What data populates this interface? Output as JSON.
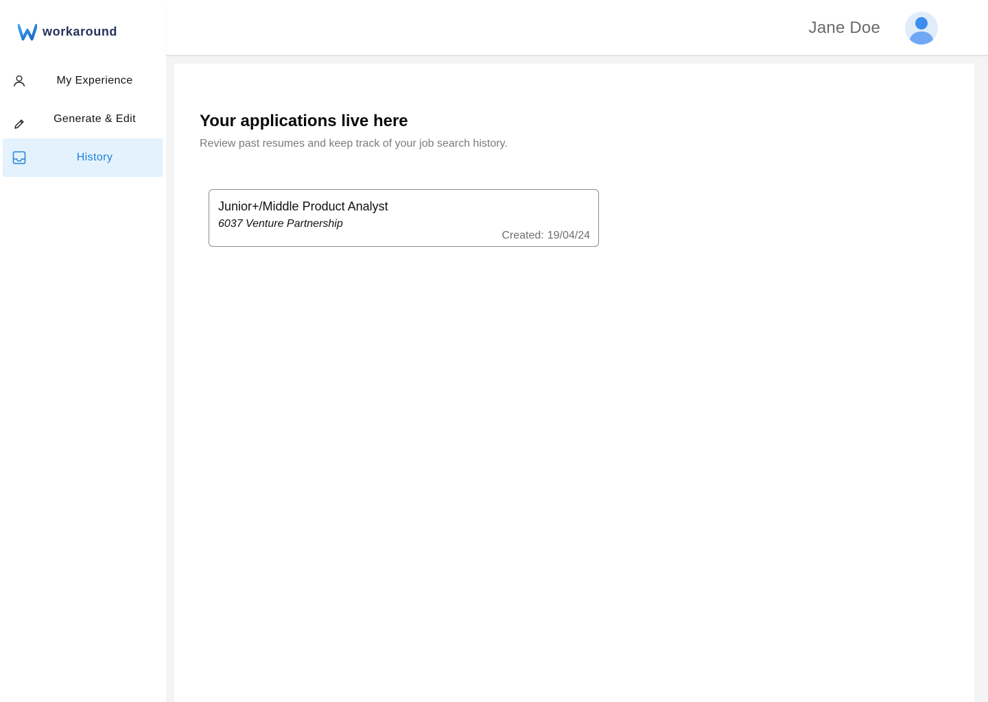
{
  "brand": {
    "name": "workaround",
    "icon": "w-logo-icon",
    "color": "#24335a",
    "accent": "#2196f3"
  },
  "sidebar": {
    "items": [
      {
        "label": "My Experience",
        "icon": "user-icon",
        "active": false
      },
      {
        "label": "Generate & Edit",
        "icon": "pencil-icon",
        "active": false
      },
      {
        "label": "History",
        "icon": "inbox-icon",
        "active": true
      }
    ],
    "active_color": "#1e7fd6",
    "active_bg": "#e3f2fd"
  },
  "header": {
    "user_name": "Jane Doe",
    "avatar_icon": "avatar-icon"
  },
  "main": {
    "title": "Your applications live here",
    "subtitle": "Review past resumes and keep track of your job search history.",
    "applications": [
      {
        "title": "Junior+/Middle Product Analyst",
        "company": "6037 Venture Partnership",
        "created_label": "Created:",
        "created_date": "19/04/24"
      }
    ]
  }
}
